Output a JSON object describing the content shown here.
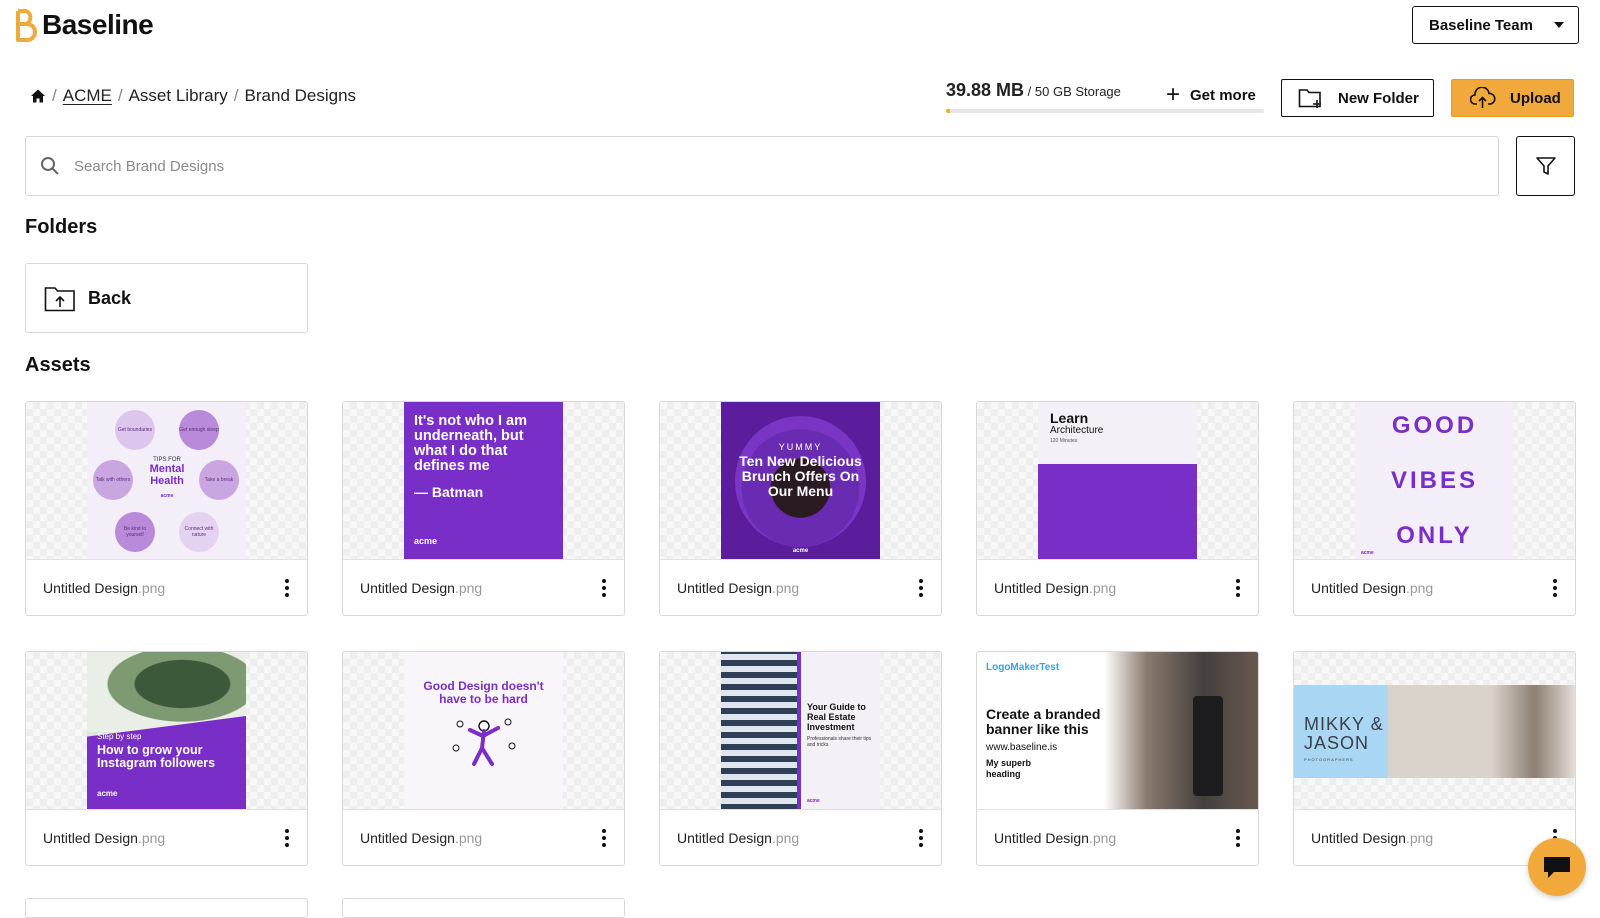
{
  "app": {
    "name": "Baseline",
    "team": "Baseline Team"
  },
  "breadcrumb": {
    "items": [
      "ACME",
      "Asset Library",
      "Brand Designs"
    ]
  },
  "storage": {
    "used": "39.88 MB",
    "total": "/ 50 GB Storage",
    "used_fraction": 0.0008
  },
  "toolbar": {
    "get_more": "Get more",
    "new_folder": "New Folder",
    "upload": "Upload"
  },
  "search": {
    "placeholder": "Search Brand Designs",
    "value": ""
  },
  "sections": {
    "folders": "Folders",
    "assets": "Assets"
  },
  "folders": [
    {
      "label": "Back"
    }
  ],
  "assets": [
    {
      "name": "Untitled Design",
      "ext": ".png",
      "art": {
        "title": "Mental Health",
        "kicker": "TIPS FOR",
        "bubbles": [
          "Get boundaries",
          "Get enough sleep",
          "Talk with others",
          "Take a break",
          "Be kind to yourself",
          "Connect with nature"
        ],
        "brand": "acme"
      }
    },
    {
      "name": "Untitled Design",
      "ext": ".png",
      "art": {
        "quote": "It's not who I am underneath, but what I do that defines me",
        "author": "— Batman",
        "brand": "acme"
      }
    },
    {
      "name": "Untitled Design",
      "ext": ".png",
      "art": {
        "kicker": "YUMMY",
        "title": "Ten New Delicious Brunch Offers On Our Menu",
        "brand": "acme"
      }
    },
    {
      "name": "Untitled Design",
      "ext": ".png",
      "art": {
        "title": "Learn",
        "subtitle": "Architecture",
        "meta": "120 Minutes"
      }
    },
    {
      "name": "Untitled Design",
      "ext": ".png",
      "art": {
        "line1": "GOOD",
        "line2": "VIBES",
        "line3": "ONLY",
        "brand": "acme"
      }
    },
    {
      "name": "Untitled Design",
      "ext": ".png",
      "art": {
        "kicker": "Step by step",
        "title": "How to grow your Instagram followers",
        "brand": "acme"
      }
    },
    {
      "name": "Untitled Design",
      "ext": ".png",
      "art": {
        "title": "Good Design doesn't have to be hard"
      }
    },
    {
      "name": "Untitled Design",
      "ext": ".png",
      "art": {
        "title": "Your Guide to Real Estate Investment",
        "subtitle": "Professionals share their tips and tricks",
        "brand": "acme"
      }
    },
    {
      "name": "Untitled Design",
      "ext": ".png",
      "art": {
        "kicker": "LogoMakerTest",
        "title": "Create a branded banner like this",
        "url": "www.baseline.is",
        "sub": "My superb heading"
      }
    },
    {
      "name": "Untitled Design",
      "ext": ".png",
      "art": {
        "title": "MIKKY & JASON",
        "sub": "PHOTOGRAPHERS"
      }
    }
  ],
  "colors": {
    "accent": "#f2a93b",
    "purple": "#7a2ec8",
    "border": "#d8d8d8"
  }
}
